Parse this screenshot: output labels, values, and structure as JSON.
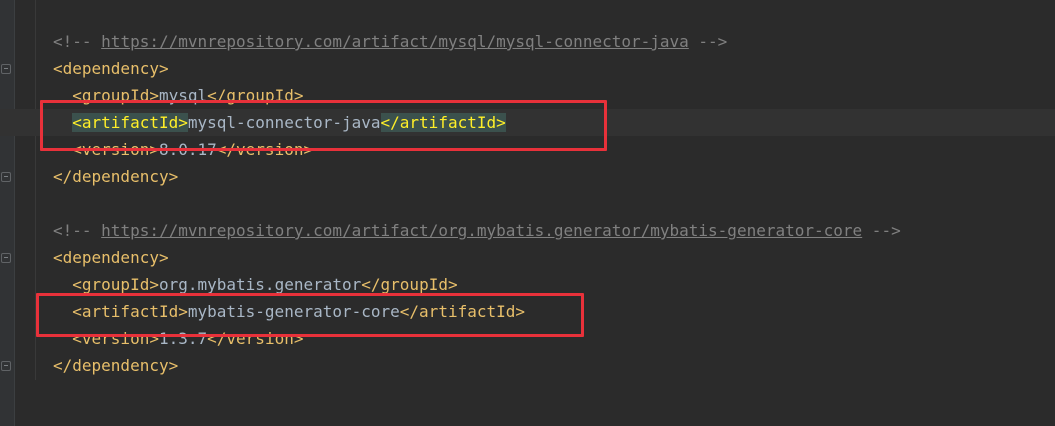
{
  "editor": {
    "lines": [
      {
        "kind": "comment",
        "open": "<!-- ",
        "url": "https://mvnrepository.com/artifact/mysql/mysql-connector-java",
        "close": " -->"
      },
      {
        "kind": "tag",
        "text": "<dependency>"
      },
      {
        "kind": "element",
        "open": "<groupId>",
        "value": "mysql",
        "close": "</groupId>"
      },
      {
        "kind": "element",
        "open": "<artifactId>",
        "value": "mysql-connector-java",
        "close": "</artifactId>"
      },
      {
        "kind": "element",
        "open": "<version>",
        "value": "8.0.17",
        "close": "</version>"
      },
      {
        "kind": "tag",
        "text": "</dependency>"
      },
      {
        "kind": "comment",
        "open": "<!-- ",
        "url": "https://mvnrepository.com/artifact/org.mybatis.generator/mybatis-generator-core",
        "close": " -->"
      },
      {
        "kind": "tag",
        "text": "<dependency>"
      },
      {
        "kind": "element",
        "open": "<groupId>",
        "value": "org.mybatis.generator",
        "close": "</groupId>"
      },
      {
        "kind": "element",
        "open": "<artifactId>",
        "value": "mybatis-generator-core",
        "close": "</artifactId>"
      },
      {
        "kind": "element",
        "open": "<version>",
        "value": "1.3.7",
        "close": "</version>"
      },
      {
        "kind": "tag",
        "text": "</dependency>"
      }
    ]
  },
  "colors": {
    "background": "#2b2b2b",
    "tag": "#e8bf6a",
    "text": "#a9b7c6",
    "comment": "#808080",
    "highlight_box": "#e8313a",
    "matched_tag_bg": "#3b514d"
  }
}
